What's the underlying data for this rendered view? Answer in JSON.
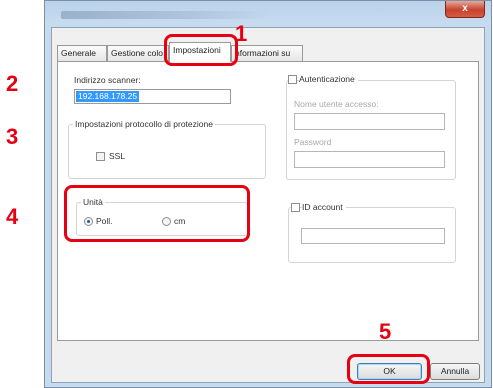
{
  "window": {
    "close_symbol": "x"
  },
  "tabs": [
    {
      "label": "Generale"
    },
    {
      "label": "Gestione colo"
    },
    {
      "label": "Impostazioni"
    },
    {
      "label": "nformazioni su"
    }
  ],
  "scanner": {
    "address_label": "Indirizzo scanner:",
    "address_value": "192.168.178.25"
  },
  "protocol": {
    "title": "Impostazioni protocollo di protezione",
    "ssl_label": "SSL"
  },
  "units": {
    "title": "Unità",
    "options": [
      {
        "label": "Poll.",
        "checked": true
      },
      {
        "label": "cm",
        "checked": false
      }
    ]
  },
  "auth": {
    "label": "Autenticazione",
    "username_label": "Nome utente accesso:",
    "password_label": "Password"
  },
  "id_account": {
    "label": "ID account"
  },
  "buttons": {
    "ok": "OK",
    "cancel": "Annulla"
  },
  "steps": [
    "1",
    "2",
    "3",
    "4",
    "5"
  ],
  "colors": {
    "highlight": "#e60012"
  }
}
